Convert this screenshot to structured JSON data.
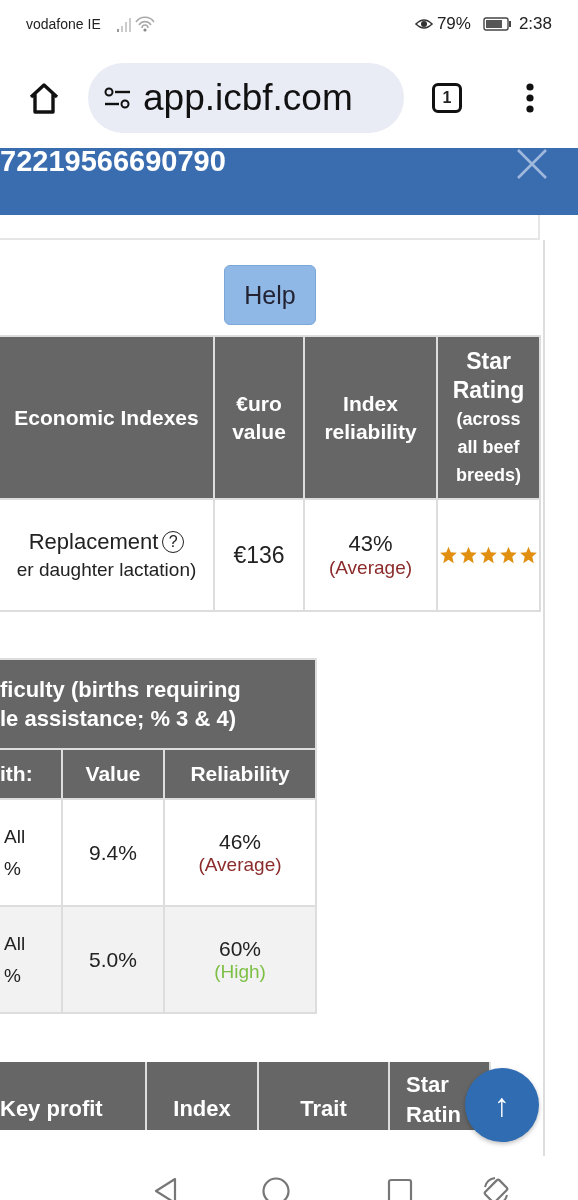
{
  "status_bar": {
    "carrier": "vodafone IE",
    "battery": "79%",
    "time": "2:38"
  },
  "browser": {
    "url": "app.icbf.com",
    "tab_count": "1"
  },
  "header": {
    "title": "72219566690790"
  },
  "help_button": "Help",
  "index_table": {
    "columns": [
      {
        "label": "Economic Indexes"
      },
      {
        "label": "€uro value"
      },
      {
        "label": "Index reliability"
      },
      {
        "label": "Star Rating",
        "note": "(across all beef breeds)"
      }
    ],
    "rows": [
      {
        "name": "Replacement",
        "help": "?",
        "unit": "er daughter lactation)",
        "value": "€136",
        "reliability": "43%",
        "rating": "(Average)",
        "kind": "average",
        "stars": 5
      }
    ]
  },
  "calving_table": {
    "title_lines": [
      "ficulty (births requiring",
      "le assistance; % 3 & 4)"
    ],
    "columns": [
      "ith:",
      "Value",
      "Reliability"
    ],
    "rows": [
      {
        "label_lines": [
          "All",
          "%"
        ],
        "value": "9.4%",
        "reliability": "46%",
        "rating": "(Average)",
        "kind": "average"
      },
      {
        "label_lines": [
          "All",
          "%"
        ],
        "value": "5.0%",
        "reliability": "60%",
        "rating": "(High)",
        "kind": "high"
      }
    ]
  },
  "profit_table": {
    "columns": [
      "Key profit",
      "Index",
      "Trait",
      "Star Ratin"
    ]
  },
  "scroll_top_button": "↑"
}
